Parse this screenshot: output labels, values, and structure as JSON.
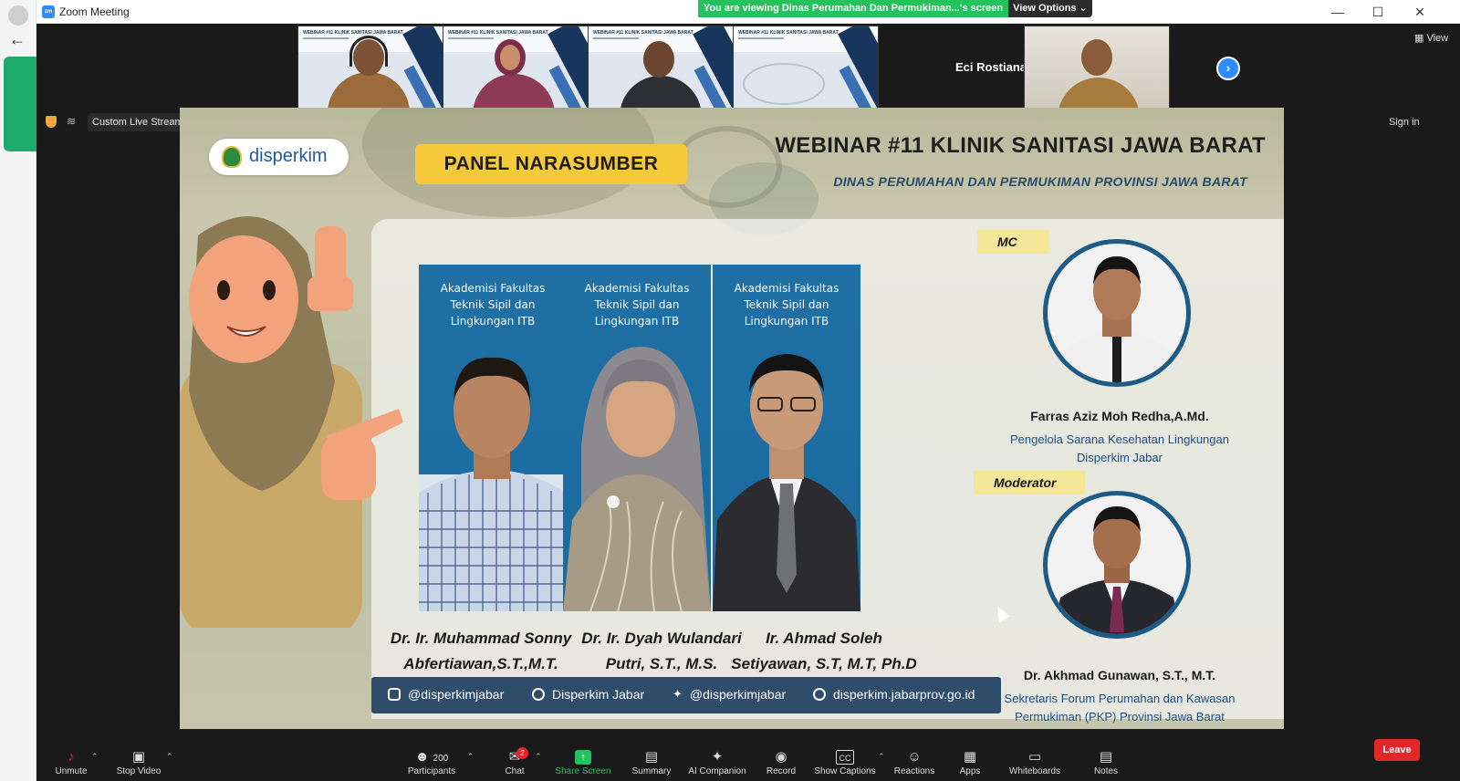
{
  "window": {
    "title": "Zoom Meeting",
    "share_banner": "You are viewing Dinas Perumahan Dan Permukiman...'s screen",
    "view_options": "View Options"
  },
  "gallery": {
    "thumb_slide_title": "WEBINAR #11 KLINIK SANITASI JAWA BARAT",
    "name_tile": "Eci Rostiana",
    "view_label": "View"
  },
  "status": {
    "live_label": "Custom Live Streaming Service",
    "signin": "Sign in"
  },
  "slide": {
    "logo_text": "disperkim",
    "panel_label": "PANEL NARASUMBER",
    "title": "WEBINAR #11 KLINIK SANITASI JAWA BARAT",
    "subtitle": "DINAS PERUMAHAN DAN PERMUKIMAN PROVINSI JAWA BARAT",
    "speakers": [
      {
        "affiliation": [
          "Akademisi Fakultas",
          "Teknik Sipil dan",
          "Lingkungan ITB"
        ],
        "name": [
          "Dr. Ir. Muhammad Sonny",
          "Abfertiawan,S.T.,M.T."
        ]
      },
      {
        "affiliation": [
          "Akademisi Fakultas",
          "Teknik Sipil dan",
          "Lingkungan ITB"
        ],
        "name": [
          "Dr. Ir. Dyah Wulandari",
          "Putri, S.T., M.S."
        ]
      },
      {
        "affiliation": [
          "Akademisi Fakultas",
          "Teknik Sipil dan",
          "Lingkungan ITB"
        ],
        "name": [
          "Ir. Ahmad Soleh",
          "Setiyawan, S.T, M.T, Ph.D"
        ]
      }
    ],
    "mc": {
      "tag": "MC",
      "name": "Farras Aziz Moh Redha,A.Md.",
      "desc": [
        "Pengelola Sarana Kesehatan Lingkungan",
        "Disperkim Jabar"
      ]
    },
    "moderator": {
      "tag": "Moderator",
      "name": "Dr. Akhmad Gunawan, S.T., M.T.",
      "desc": [
        "Sekretaris Forum Perumahan dan Kawasan",
        "Permukiman (PKP) Provinsi Jawa Barat"
      ]
    },
    "social": {
      "instagram": "@disperkimjabar",
      "facebook": "Disperkim Jabar",
      "twitter": "@disperkimjabar",
      "web": "disperkim.jabarprov.go.id"
    }
  },
  "toolbar": {
    "unmute": "Unmute",
    "stop_video": "Stop Video",
    "participants": "Participants",
    "participants_count": "200",
    "chat": "Chat",
    "chat_badge": "2",
    "share_screen": "Share Screen",
    "summary": "Summary",
    "ai_companion": "AI Companion",
    "record": "Record",
    "show_captions": "Show Captions",
    "reactions": "Reactions",
    "apps": "Apps",
    "whiteboards": "Whiteboards",
    "notes": "Notes",
    "leave": "Leave"
  }
}
